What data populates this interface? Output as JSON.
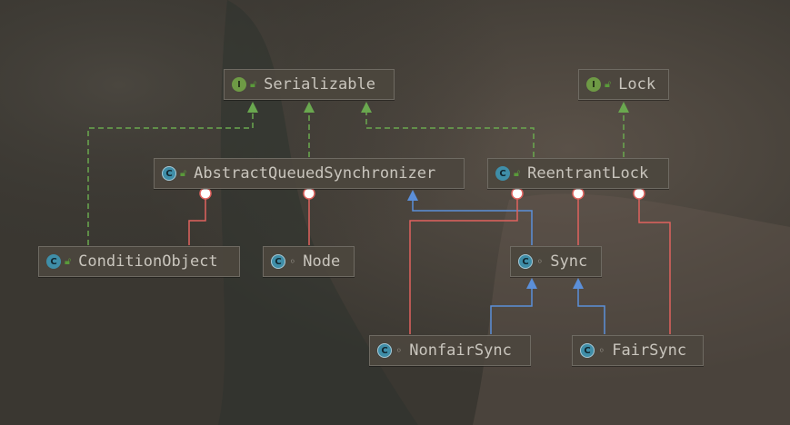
{
  "colors": {
    "background": "#3b3832",
    "node_fill": "#4c473e",
    "node_border": "#6e6a62",
    "text": "#c9c5bd",
    "implements_edge": "#6aa84f",
    "extends_edge": "#5b8fd9",
    "inner_class_edge": "#e0625e",
    "interface_badge": "#6e9a45",
    "class_badge": "#3f8ea8"
  },
  "nodes": {
    "serializable": {
      "label": "Serializable",
      "badge": "I",
      "kind": "interface",
      "visibility_icon": "unlocked-icon"
    },
    "lock": {
      "label": "Lock",
      "badge": "I",
      "kind": "interface",
      "visibility_icon": "unlocked-icon"
    },
    "aqs": {
      "label": "AbstractQueuedSynchronizer",
      "badge": "C",
      "kind": "abstract",
      "visibility_icon": "unlocked-icon"
    },
    "reentrant_lock": {
      "label": "ReentrantLock",
      "badge": "C",
      "kind": "class",
      "visibility_icon": "unlocked-icon"
    },
    "condition_object": {
      "label": "ConditionObject",
      "badge": "C",
      "kind": "class",
      "visibility_icon": "unlocked-icon"
    },
    "node": {
      "label": "Node",
      "badge": "C",
      "kind": "abstract",
      "visibility_icon": "package-dot-icon"
    },
    "sync": {
      "label": "Sync",
      "badge": "C",
      "kind": "abstract",
      "visibility_icon": "package-dot-icon"
    },
    "nonfair_sync": {
      "label": "NonfairSync",
      "badge": "C",
      "kind": "abstract",
      "visibility_icon": "package-dot-icon"
    },
    "fair_sync": {
      "label": "FairSync",
      "badge": "C",
      "kind": "abstract",
      "visibility_icon": "package-dot-icon"
    }
  },
  "relations": [
    {
      "from": "condition_object",
      "to": "serializable",
      "type": "implements"
    },
    {
      "from": "aqs",
      "to": "serializable",
      "type": "implements"
    },
    {
      "from": "reentrant_lock",
      "to": "serializable",
      "type": "implements"
    },
    {
      "from": "reentrant_lock",
      "to": "lock",
      "type": "implements"
    },
    {
      "from": "sync",
      "to": "aqs",
      "type": "extends"
    },
    {
      "from": "nonfair_sync",
      "to": "sync",
      "type": "extends"
    },
    {
      "from": "fair_sync",
      "to": "sync",
      "type": "extends"
    },
    {
      "from": "condition_object",
      "to": "aqs",
      "type": "inner-class"
    },
    {
      "from": "node",
      "to": "aqs",
      "type": "inner-class"
    },
    {
      "from": "nonfair_sync",
      "to": "reentrant_lock",
      "type": "inner-class"
    },
    {
      "from": "sync",
      "to": "reentrant_lock",
      "type": "inner-class"
    },
    {
      "from": "fair_sync",
      "to": "reentrant_lock",
      "type": "inner-class"
    }
  ]
}
